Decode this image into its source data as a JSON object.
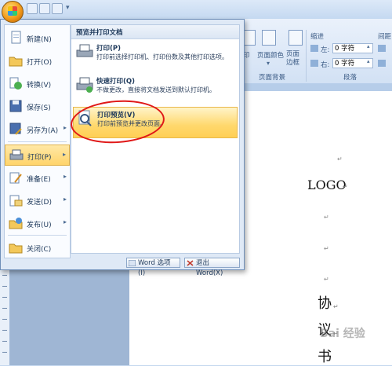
{
  "ribbon": {
    "page_color_label": "页面颜色",
    "page_border_label": "页面\n边框",
    "background_group": "页面背景",
    "indent_group": "缩进",
    "spacing_group": "间距",
    "paragraph_group": "段落",
    "left_label": "左:",
    "right_label": "右:",
    "left_value": "0 字符",
    "right_value": "0 字符",
    "partial_label": "印"
  },
  "menu": {
    "items": [
      {
        "label": "新建(N)",
        "icon": "new-doc-icon"
      },
      {
        "label": "打开(O)",
        "icon": "open-folder-icon"
      },
      {
        "label": "转换(V)",
        "icon": "convert-icon"
      },
      {
        "label": "保存(S)",
        "icon": "save-icon"
      },
      {
        "label": "另存为(A)",
        "icon": "save-as-icon",
        "arrow": true
      },
      {
        "label": "打印(P)",
        "icon": "printer-icon",
        "arrow": true,
        "active": true
      },
      {
        "label": "准备(E)",
        "icon": "prepare-icon",
        "arrow": true
      },
      {
        "label": "发送(D)",
        "icon": "send-icon",
        "arrow": true
      },
      {
        "label": "发布(U)",
        "icon": "publish-icon",
        "arrow": true
      },
      {
        "label": "关闭(C)",
        "icon": "close-doc-icon"
      }
    ],
    "panel_title": "预览并打印文档",
    "options": [
      {
        "title": "打印(P)",
        "desc": "打印前选择打印机、打印份数及其他打印选项。",
        "icon": "printer-icon"
      },
      {
        "title": "快速打印(Q)",
        "desc": "不做更改，直接将文档发送到默认打印机。",
        "icon": "quick-print-icon"
      },
      {
        "title": "打印预览(V)",
        "desc": "打印前预览并更改页面。",
        "icon": "print-preview-icon"
      }
    ],
    "word_options_label": "Word 选项(I)",
    "exit_word_label": "退出 Word(X)"
  },
  "document": {
    "logo_text": "LOGO",
    "para_mark": "↵",
    "chars": [
      "协",
      "议",
      "书"
    ]
  },
  "watermark": "Bai 经验"
}
